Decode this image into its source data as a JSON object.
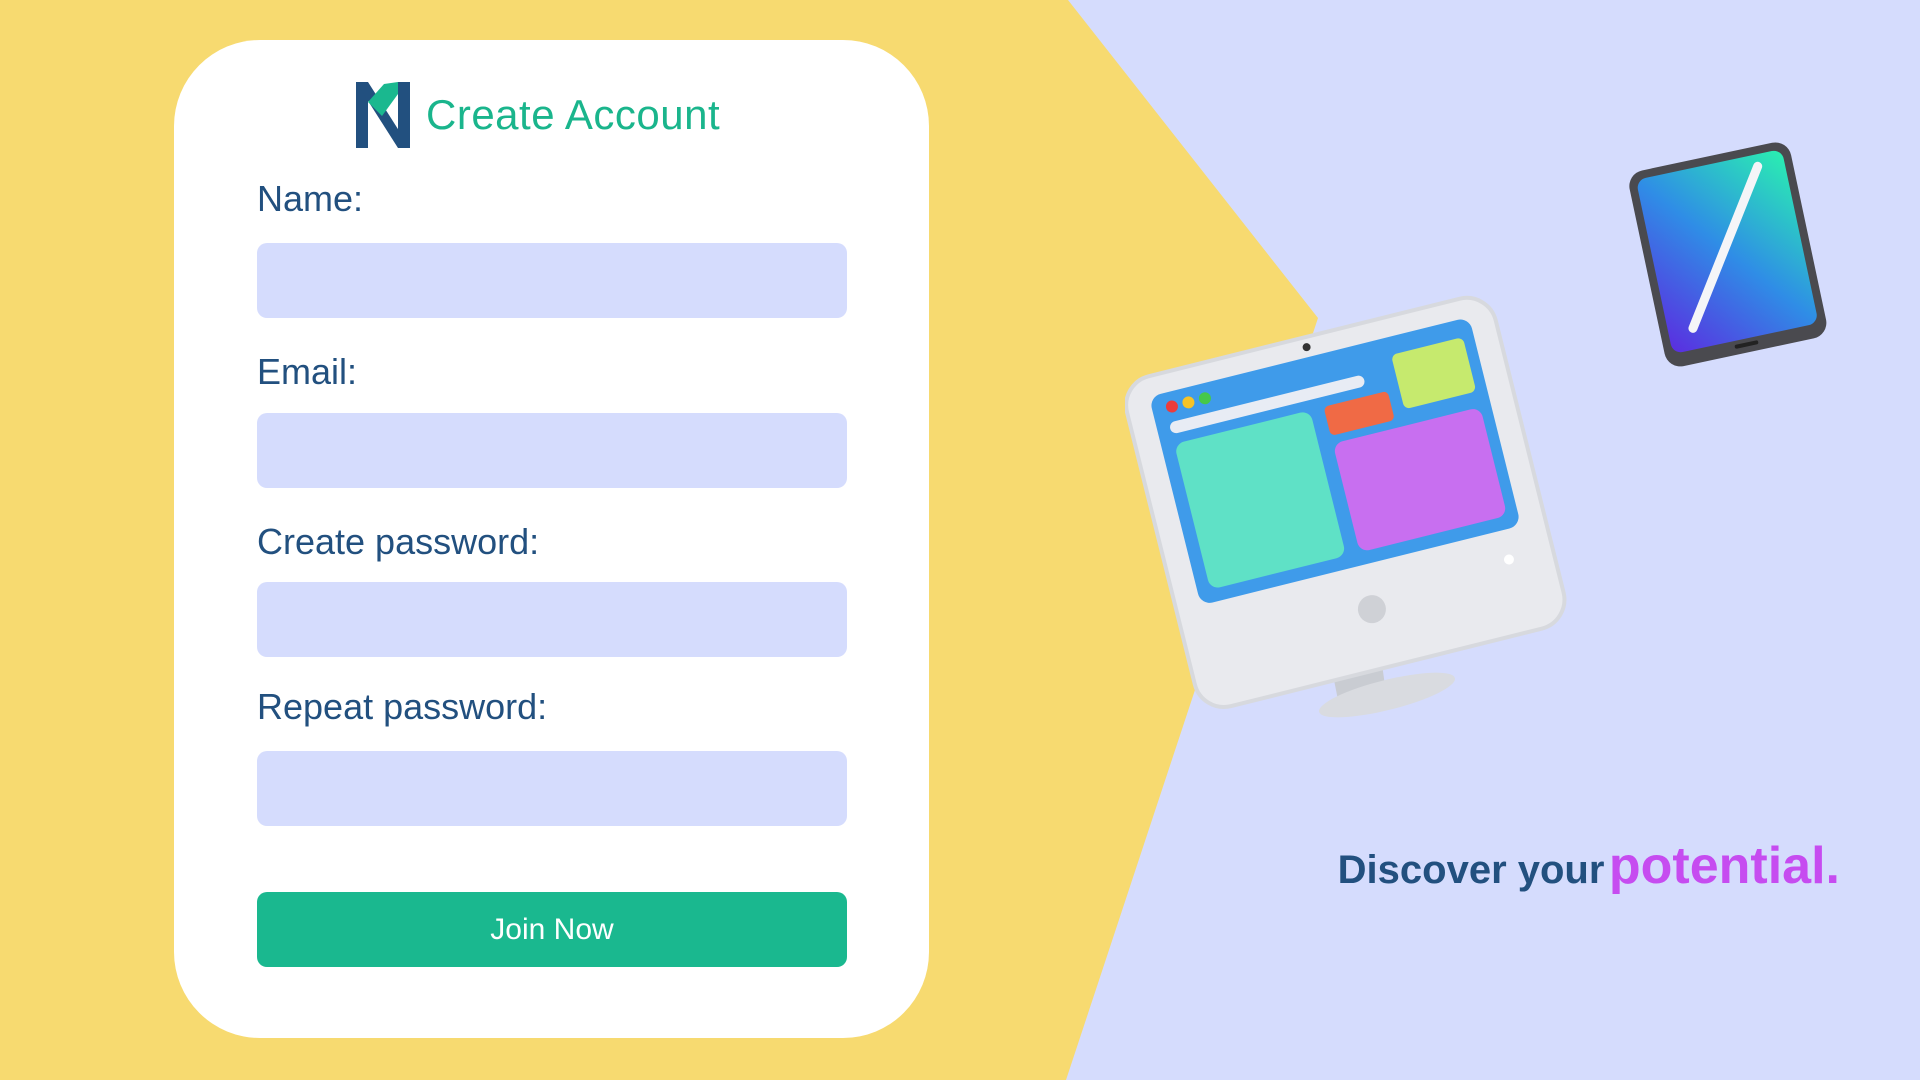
{
  "form": {
    "title": "Create Account",
    "fields": [
      {
        "label": "Name:",
        "value": "",
        "placeholder": ""
      },
      {
        "label": "Email:",
        "value": "",
        "placeholder": ""
      },
      {
        "label": "Create password:",
        "value": "",
        "placeholder": ""
      },
      {
        "label": "Repeat password:",
        "value": "",
        "placeholder": ""
      }
    ],
    "submit_label": "Join Now"
  },
  "tagline": {
    "part1": "Discover your",
    "part2": "potential."
  },
  "colors": {
    "background_yellow": "#f7da70",
    "background_lavender": "#d5dcfd",
    "accent_green": "#1ab88f",
    "text_navy": "#22507f",
    "accent_purple": "#c64cf0"
  },
  "icons": {
    "logo": "n-logo-icon",
    "illustration_computer": "imac-illustration",
    "illustration_tablet": "tablet-pencil-illustration"
  }
}
